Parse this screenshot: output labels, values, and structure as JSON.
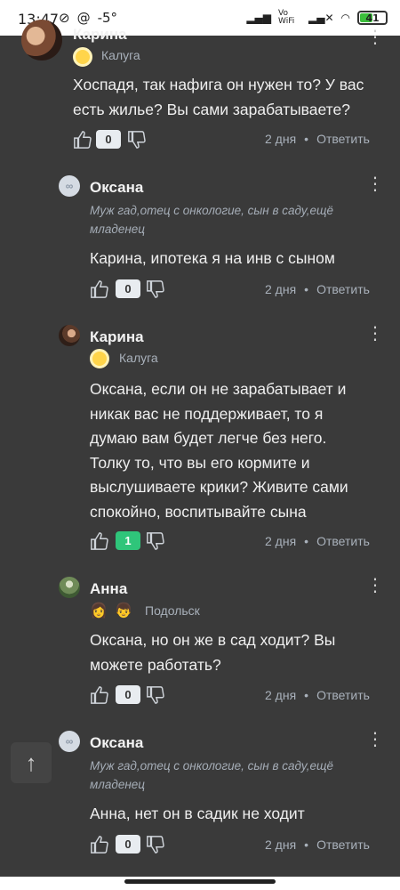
{
  "status_bar": {
    "time": "13:47",
    "temp": "-5°",
    "network": "Vo WiFi",
    "battery_level": "41"
  },
  "comments": [
    {
      "author": "Карина",
      "city": "Калуга",
      "text_lines": [
        "Хоспадя, так нафига он нужен то? У вас",
        "есть жилье? Вы сами зарабатываете?"
      ],
      "score": "0",
      "age": "2 дня",
      "reply_label": "Ответить"
    },
    {
      "author": "Оксана",
      "status_lines": [
        "Муж гад,отец с онкологие, сын в саду,ещё",
        "младенец"
      ],
      "text_lines": [
        "Карина, ипотека я на инв с сыном"
      ],
      "score": "0",
      "age": "2 дня",
      "reply_label": "Ответить"
    },
    {
      "author": "Карина",
      "city": "Калуга",
      "text_lines": [
        "Оксана, если он не зарабатывает и",
        "никак вас не поддерживает, то я",
        "думаю вам будет легче без него.",
        "Толку то, что вы его кормите и",
        "выслушиваете крики? Живите сами",
        "спокойно, воспитывайте сына"
      ],
      "score": "1",
      "age": "2 дня",
      "reply_label": "Ответить"
    },
    {
      "author": "Анна",
      "city": "Подольск",
      "text_lines": [
        "Оксана, но он же в сад ходит? Вы",
        "можете работать?"
      ],
      "score": "0",
      "age": "2 дня",
      "reply_label": "Ответить"
    },
    {
      "author": "Оксана",
      "status_lines": [
        "Муж гад,отец с онкологие, сын в саду,ещё",
        "младенец"
      ],
      "text_lines": [
        "Анна, нет он в садик не ходит"
      ],
      "score": "0",
      "age": "2 дня",
      "reply_label": "Ответить"
    }
  ],
  "icons": {
    "scroll_top": "arrow-up-icon",
    "like": "thumb-up-icon",
    "dislike": "thumb-down-icon",
    "more": "more-vertical-icon"
  },
  "colors": {
    "background": "#3a3a3a",
    "positive_score": "#2fc57a",
    "meta_text": "#a9b1bb"
  }
}
